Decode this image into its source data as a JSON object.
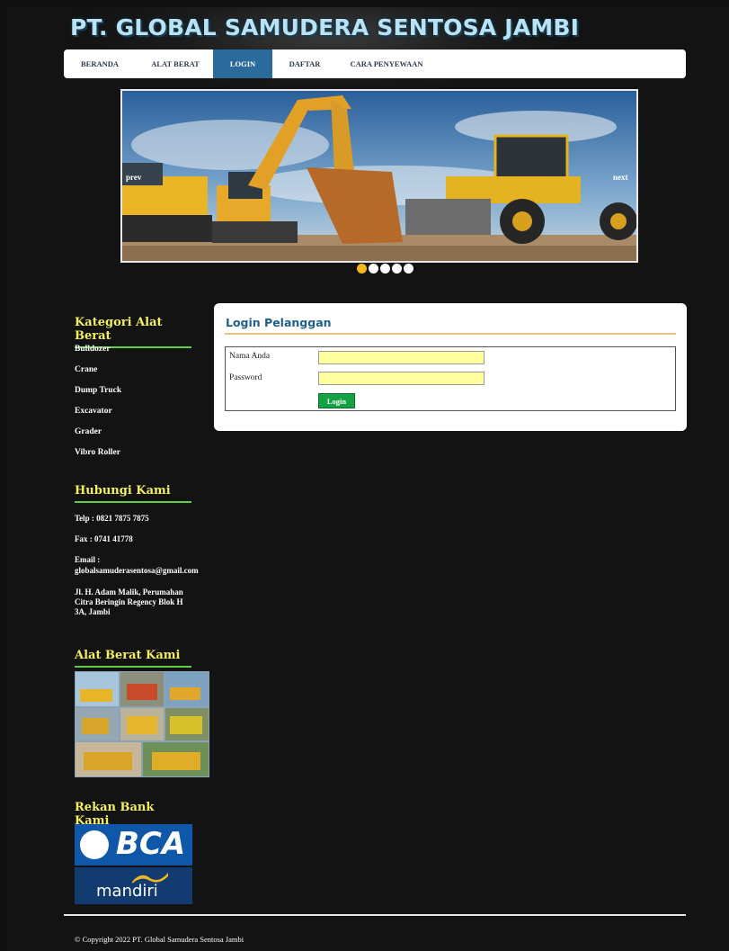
{
  "site": {
    "title": "PT. GLOBAL SAMUDERA SENTOSA JAMBI"
  },
  "nav": {
    "items": [
      {
        "label": "BERANDA",
        "active": false
      },
      {
        "label": "ALAT BERAT",
        "active": false
      },
      {
        "label": "LOGIN",
        "active": true
      },
      {
        "label": "DAFTAR",
        "active": false
      },
      {
        "label": "CARA PENYEWAAN",
        "active": false
      }
    ]
  },
  "slider": {
    "prev_label": "prev",
    "next_label": "next",
    "slide_count": 5,
    "active_index": 0
  },
  "sidebar": {
    "categories": {
      "heading": "Kategori Alat Berat",
      "items": [
        "Bulldozer",
        "Crane",
        "Dump Truck",
        "Excavator",
        "Grader",
        "Vibro Roller"
      ]
    },
    "contact": {
      "heading": "Hubungi Kami",
      "phone": "Telp : 0821 7875 7875",
      "fax": "Fax : 0741 41778",
      "email_label": "Email :",
      "email": "globalsamuderasentosa@gmail.com",
      "address": "Jl. H. Adam Malik, Perumahan Citra Beringin Regency Blok H 3A, Jambi"
    },
    "equipment": {
      "heading": "Alat Berat Kami"
    },
    "banks": {
      "heading": "Rekan Bank Kami",
      "bca_text": "BCA",
      "mandiri_text": "mandiri"
    }
  },
  "login": {
    "title": "Login Pelanggan",
    "name_label": "Nama Anda",
    "name_value": "",
    "password_label": "Password",
    "password_value": "",
    "button_label": "Login"
  },
  "footer": {
    "copyright": "© Copyright 2022 PT. Global Samudera Sentosa Jambi"
  },
  "colors": {
    "accent_blue": "#2a6b9b",
    "heading_yellow": "#f4ef5e",
    "underline_green": "#5fcd45",
    "input_yellow": "#ffff9e",
    "button_green": "#14a244"
  }
}
